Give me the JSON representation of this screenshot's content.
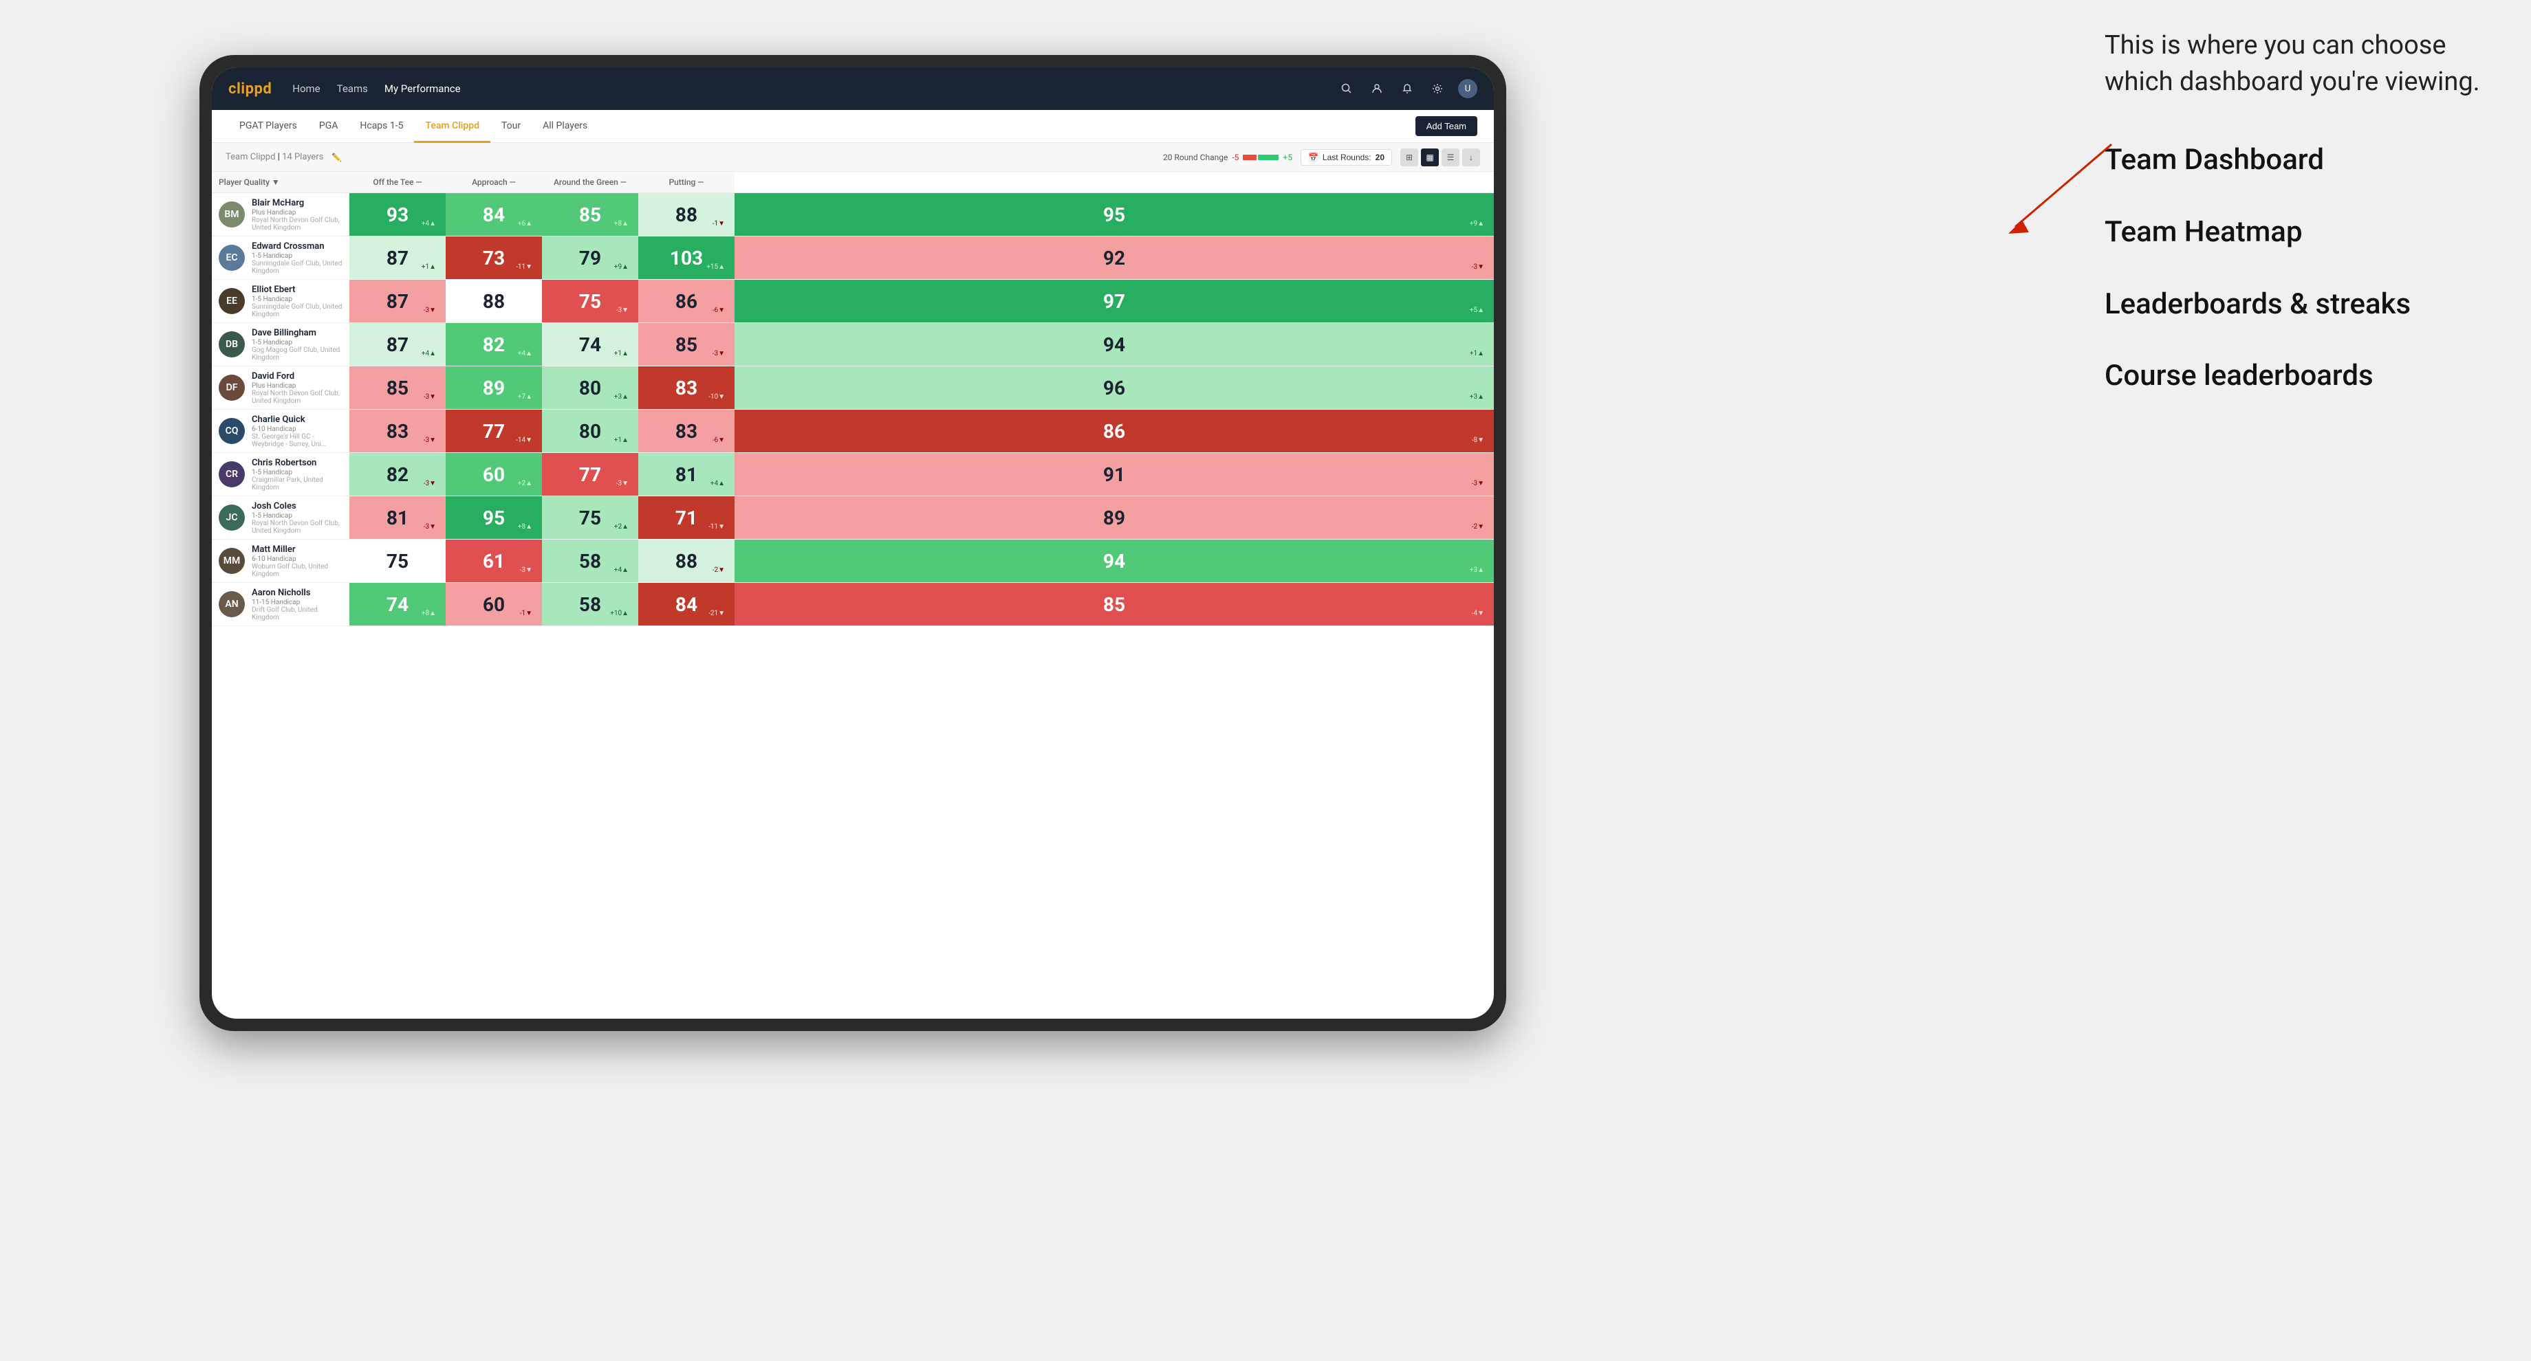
{
  "annotation": {
    "intro_text": "This is where you can choose which dashboard you're viewing.",
    "items": [
      "Team Dashboard",
      "Team Heatmap",
      "Leaderboards & streaks",
      "Course leaderboards"
    ]
  },
  "nav": {
    "logo": "clippd",
    "links": [
      "Home",
      "Teams",
      "My Performance"
    ],
    "active_link": "My Performance"
  },
  "sub_nav": {
    "links": [
      "PGAT Players",
      "PGA",
      "Hcaps 1-5",
      "Team Clippd",
      "Tour",
      "All Players"
    ],
    "active_link": "Team Clippd",
    "add_team_label": "Add Team"
  },
  "team_header": {
    "title": "Team Clippd",
    "count": "14 Players",
    "round_change_label": "20 Round Change",
    "change_neg": "-5",
    "change_pos": "+5",
    "last_rounds_label": "Last Rounds:",
    "last_rounds_value": "20"
  },
  "table": {
    "columns": {
      "player": "Player Quality ▼",
      "off_tee": "Off the Tee —",
      "approach": "Approach —",
      "around_green": "Around the Green —",
      "putting": "Putting —"
    },
    "players": [
      {
        "name": "Blair McHarg",
        "handicap": "Plus Handicap",
        "club": "Royal North Devon Golf Club, United Kingdom",
        "avatar_color": "#7a8a6a",
        "avatar_initials": "BM",
        "scores": {
          "quality": {
            "value": 93,
            "change": "+4",
            "dir": "up",
            "bg": "bg-dark-green",
            "text": "dark"
          },
          "off_tee": {
            "value": 84,
            "change": "+6",
            "dir": "up",
            "bg": "bg-med-green",
            "text": "dark"
          },
          "approach": {
            "value": 85,
            "change": "+8",
            "dir": "up",
            "bg": "bg-med-green",
            "text": "dark"
          },
          "around_green": {
            "value": 88,
            "change": "-1",
            "dir": "down",
            "bg": "bg-lightest-green",
            "text": "white"
          },
          "putting": {
            "value": 95,
            "change": "+9",
            "dir": "up",
            "bg": "bg-dark-green",
            "text": "dark"
          }
        }
      },
      {
        "name": "Edward Crossman",
        "handicap": "1-5 Handicap",
        "club": "Sunningdale Golf Club, United Kingdom",
        "avatar_color": "#5a7a9a",
        "avatar_initials": "EC",
        "scores": {
          "quality": {
            "value": 87,
            "change": "+1",
            "dir": "up",
            "bg": "bg-lightest-green",
            "text": "white"
          },
          "off_tee": {
            "value": 73,
            "change": "-11",
            "dir": "down",
            "bg": "bg-dark-red",
            "text": "dark"
          },
          "approach": {
            "value": 79,
            "change": "+9",
            "dir": "up",
            "bg": "bg-light-green",
            "text": "white"
          },
          "around_green": {
            "value": 103,
            "change": "+15",
            "dir": "up",
            "bg": "bg-dark-green",
            "text": "dark"
          },
          "putting": {
            "value": 92,
            "change": "-3",
            "dir": "down",
            "bg": "bg-light-red",
            "text": "white"
          }
        }
      },
      {
        "name": "Elliot Ebert",
        "handicap": "1-5 Handicap",
        "club": "Sunningdale Golf Club, United Kingdom",
        "avatar_color": "#4a3a2a",
        "avatar_initials": "EE",
        "scores": {
          "quality": {
            "value": 87,
            "change": "-3",
            "dir": "down",
            "bg": "bg-light-red",
            "text": "white"
          },
          "off_tee": {
            "value": 88,
            "change": "",
            "dir": "",
            "bg": "bg-white",
            "text": "white"
          },
          "approach": {
            "value": 75,
            "change": "-3",
            "dir": "down",
            "bg": "bg-med-red",
            "text": "dark"
          },
          "around_green": {
            "value": 86,
            "change": "-6",
            "dir": "down",
            "bg": "bg-light-red",
            "text": "white"
          },
          "putting": {
            "value": 97,
            "change": "+5",
            "dir": "up",
            "bg": "bg-dark-green",
            "text": "dark"
          }
        }
      },
      {
        "name": "Dave Billingham",
        "handicap": "1-5 Handicap",
        "club": "Gog Magog Golf Club, United Kingdom",
        "avatar_color": "#3a5a4a",
        "avatar_initials": "DB",
        "scores": {
          "quality": {
            "value": 87,
            "change": "+4",
            "dir": "up",
            "bg": "bg-lightest-green",
            "text": "white"
          },
          "off_tee": {
            "value": 82,
            "change": "+4",
            "dir": "up",
            "bg": "bg-med-green",
            "text": "dark"
          },
          "approach": {
            "value": 74,
            "change": "+1",
            "dir": "up",
            "bg": "bg-lightest-green",
            "text": "white"
          },
          "around_green": {
            "value": 85,
            "change": "-3",
            "dir": "down",
            "bg": "bg-light-red",
            "text": "white"
          },
          "putting": {
            "value": 94,
            "change": "+1",
            "dir": "up",
            "bg": "bg-light-green",
            "text": "white"
          }
        }
      },
      {
        "name": "David Ford",
        "handicap": "Plus Handicap",
        "club": "Royal North Devon Golf Club, United Kingdom",
        "avatar_color": "#6a4a3a",
        "avatar_initials": "DF",
        "scores": {
          "quality": {
            "value": 85,
            "change": "-3",
            "dir": "down",
            "bg": "bg-light-red",
            "text": "white"
          },
          "off_tee": {
            "value": 89,
            "change": "+7",
            "dir": "up",
            "bg": "bg-med-green",
            "text": "dark"
          },
          "approach": {
            "value": 80,
            "change": "+3",
            "dir": "up",
            "bg": "bg-light-green",
            "text": "white"
          },
          "around_green": {
            "value": 83,
            "change": "-10",
            "dir": "down",
            "bg": "bg-dark-red",
            "text": "dark"
          },
          "putting": {
            "value": 96,
            "change": "+3",
            "dir": "up",
            "bg": "bg-light-green",
            "text": "white"
          }
        }
      },
      {
        "name": "Charlie Quick",
        "handicap": "6-10 Handicap",
        "club": "St. George's Hill GC - Weybridge - Surrey, Uni...",
        "avatar_color": "#2a4a6a",
        "avatar_initials": "CQ",
        "scores": {
          "quality": {
            "value": 83,
            "change": "-3",
            "dir": "down",
            "bg": "bg-light-red",
            "text": "white"
          },
          "off_tee": {
            "value": 77,
            "change": "-14",
            "dir": "down",
            "bg": "bg-dark-red",
            "text": "dark"
          },
          "approach": {
            "value": 80,
            "change": "+1",
            "dir": "up",
            "bg": "bg-light-green",
            "text": "white"
          },
          "around_green": {
            "value": 83,
            "change": "-6",
            "dir": "down",
            "bg": "bg-light-red",
            "text": "white"
          },
          "putting": {
            "value": 86,
            "change": "-8",
            "dir": "down",
            "bg": "bg-dark-red",
            "text": "dark"
          }
        }
      },
      {
        "name": "Chris Robertson",
        "handicap": "1-5 Handicap",
        "club": "Craigmillar Park, United Kingdom",
        "avatar_color": "#4a3a6a",
        "avatar_initials": "CR",
        "scores": {
          "quality": {
            "value": 82,
            "change": "-3",
            "dir": "down",
            "bg": "bg-light-green",
            "text": "white"
          },
          "off_tee": {
            "value": 60,
            "change": "+2",
            "dir": "up",
            "bg": "bg-med-green",
            "text": "dark"
          },
          "approach": {
            "value": 77,
            "change": "-3",
            "dir": "down",
            "bg": "bg-med-red",
            "text": "dark"
          },
          "around_green": {
            "value": 81,
            "change": "+4",
            "dir": "up",
            "bg": "bg-light-green",
            "text": "white"
          },
          "putting": {
            "value": 91,
            "change": "-3",
            "dir": "down",
            "bg": "bg-light-red",
            "text": "white"
          }
        }
      },
      {
        "name": "Josh Coles",
        "handicap": "1-5 Handicap",
        "club": "Royal North Devon Golf Club, United Kingdom",
        "avatar_color": "#3a6a5a",
        "avatar_initials": "JC",
        "scores": {
          "quality": {
            "value": 81,
            "change": "-3",
            "dir": "down",
            "bg": "bg-light-red",
            "text": "white"
          },
          "off_tee": {
            "value": 95,
            "change": "+8",
            "dir": "up",
            "bg": "bg-dark-green",
            "text": "dark"
          },
          "approach": {
            "value": 75,
            "change": "+2",
            "dir": "up",
            "bg": "bg-light-green",
            "text": "white"
          },
          "around_green": {
            "value": 71,
            "change": "-11",
            "dir": "down",
            "bg": "bg-dark-red",
            "text": "dark"
          },
          "putting": {
            "value": 89,
            "change": "-2",
            "dir": "down",
            "bg": "bg-light-red",
            "text": "white"
          }
        }
      },
      {
        "name": "Matt Miller",
        "handicap": "6-10 Handicap",
        "club": "Woburn Golf Club, United Kingdom",
        "avatar_color": "#5a4a3a",
        "avatar_initials": "MM",
        "scores": {
          "quality": {
            "value": 75,
            "change": "",
            "dir": "",
            "bg": "bg-white",
            "text": "white"
          },
          "off_tee": {
            "value": 61,
            "change": "-3",
            "dir": "down",
            "bg": "bg-med-red",
            "text": "dark"
          },
          "approach": {
            "value": 58,
            "change": "+4",
            "dir": "up",
            "bg": "bg-light-green",
            "text": "white"
          },
          "around_green": {
            "value": 88,
            "change": "-2",
            "dir": "down",
            "bg": "bg-lightest-green",
            "text": "white"
          },
          "putting": {
            "value": 94,
            "change": "+3",
            "dir": "up",
            "bg": "bg-med-green",
            "text": "dark"
          }
        }
      },
      {
        "name": "Aaron Nicholls",
        "handicap": "11-15 Handicap",
        "club": "Drift Golf Club, United Kingdom",
        "avatar_color": "#6a5a4a",
        "avatar_initials": "AN",
        "scores": {
          "quality": {
            "value": 74,
            "change": "+8",
            "dir": "up",
            "bg": "bg-med-green",
            "text": "dark"
          },
          "off_tee": {
            "value": 60,
            "change": "-1",
            "dir": "down",
            "bg": "bg-light-red",
            "text": "white"
          },
          "approach": {
            "value": 58,
            "change": "+10",
            "dir": "up",
            "bg": "bg-light-green",
            "text": "white"
          },
          "around_green": {
            "value": 84,
            "change": "-21",
            "dir": "down",
            "bg": "bg-dark-red",
            "text": "dark"
          },
          "putting": {
            "value": 85,
            "change": "-4",
            "dir": "down",
            "bg": "bg-med-red",
            "text": "dark"
          }
        }
      }
    ]
  }
}
